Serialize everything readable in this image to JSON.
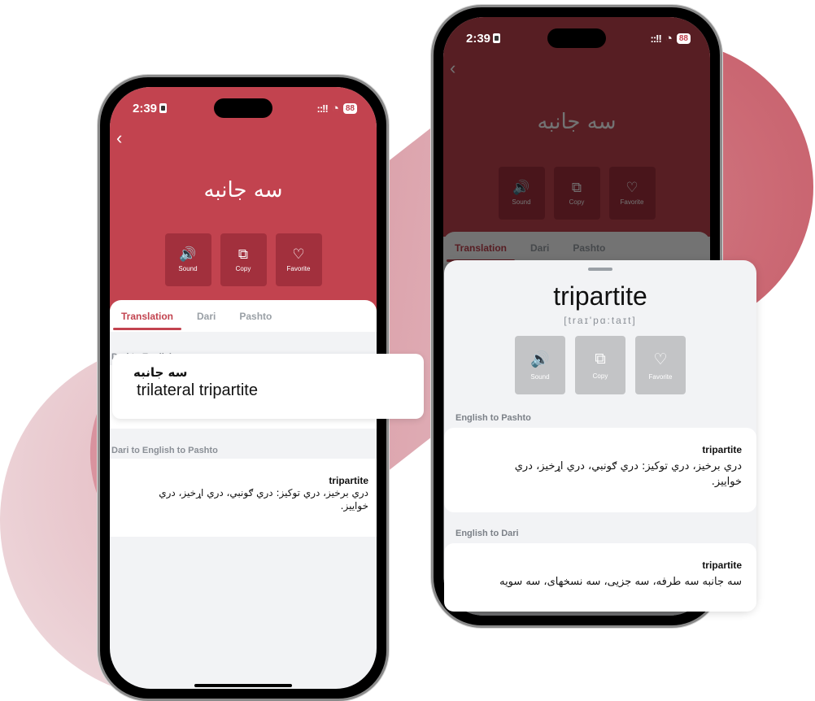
{
  "colors": {
    "brand": "#c2434f",
    "brand_dark": "#a2303d",
    "background_blob": "#cc6a75"
  },
  "left_phone": {
    "status": {
      "time": "2:39",
      "signal": "::!!",
      "wifi": "wifi-icon",
      "battery": "88"
    },
    "back_icon": "chevron-left-icon",
    "word": "سه جانبه",
    "actions": [
      {
        "label": "Sound",
        "icon": "🔊"
      },
      {
        "label": "Copy",
        "icon": "⧉"
      },
      {
        "label": "Favorite",
        "icon": "♡"
      }
    ],
    "tabs": [
      {
        "label": "Translation",
        "active": true
      },
      {
        "label": "Dari",
        "active": false
      },
      {
        "label": "Pashto",
        "active": false
      }
    ],
    "section1_label": "Dari to English",
    "highlight_card": {
      "word": "سه جانبه",
      "translation": "trilateral  tripartite"
    },
    "section2_label": "Dari to English to Pashto",
    "pashto_card": {
      "title": "tripartite",
      "text": "دري برخيز، دري توکيز: دري ګونبي، دري اړخيز، دري خواييز."
    }
  },
  "right_phone": {
    "status": {
      "time": "2:39",
      "signal": "::!!",
      "wifi": "wifi-icon",
      "battery": "88"
    },
    "back_icon": "chevron-left-icon",
    "word": "سه جانبه",
    "actions": [
      {
        "label": "Sound",
        "icon": "🔊"
      },
      {
        "label": "Copy",
        "icon": "⧉"
      },
      {
        "label": "Favorite",
        "icon": "♡"
      }
    ],
    "tabs": [
      {
        "label": "Translation",
        "active": true
      },
      {
        "label": "Dari",
        "active": false
      },
      {
        "label": "Pashto",
        "active": false
      }
    ],
    "sheet": {
      "word": "tripartite",
      "ipa": "[traɪ'pɑ:taɪt]",
      "actions": [
        {
          "label": "Sound",
          "icon": "🔊"
        },
        {
          "label": "Copy",
          "icon": "⧉"
        },
        {
          "label": "Favorite",
          "icon": "♡"
        }
      ],
      "sections": [
        {
          "label": "English to Pashto",
          "title": "tripartite",
          "text": "دري برخيز، دري توکيز: دري ګونبي، دري اړخيز، دري خواييز."
        },
        {
          "label": "English to Dari",
          "title": "tripartite",
          "text": "سه جانبه سه طرفه، سه جزیی، سه نسخهای، سه سویه"
        }
      ]
    }
  }
}
